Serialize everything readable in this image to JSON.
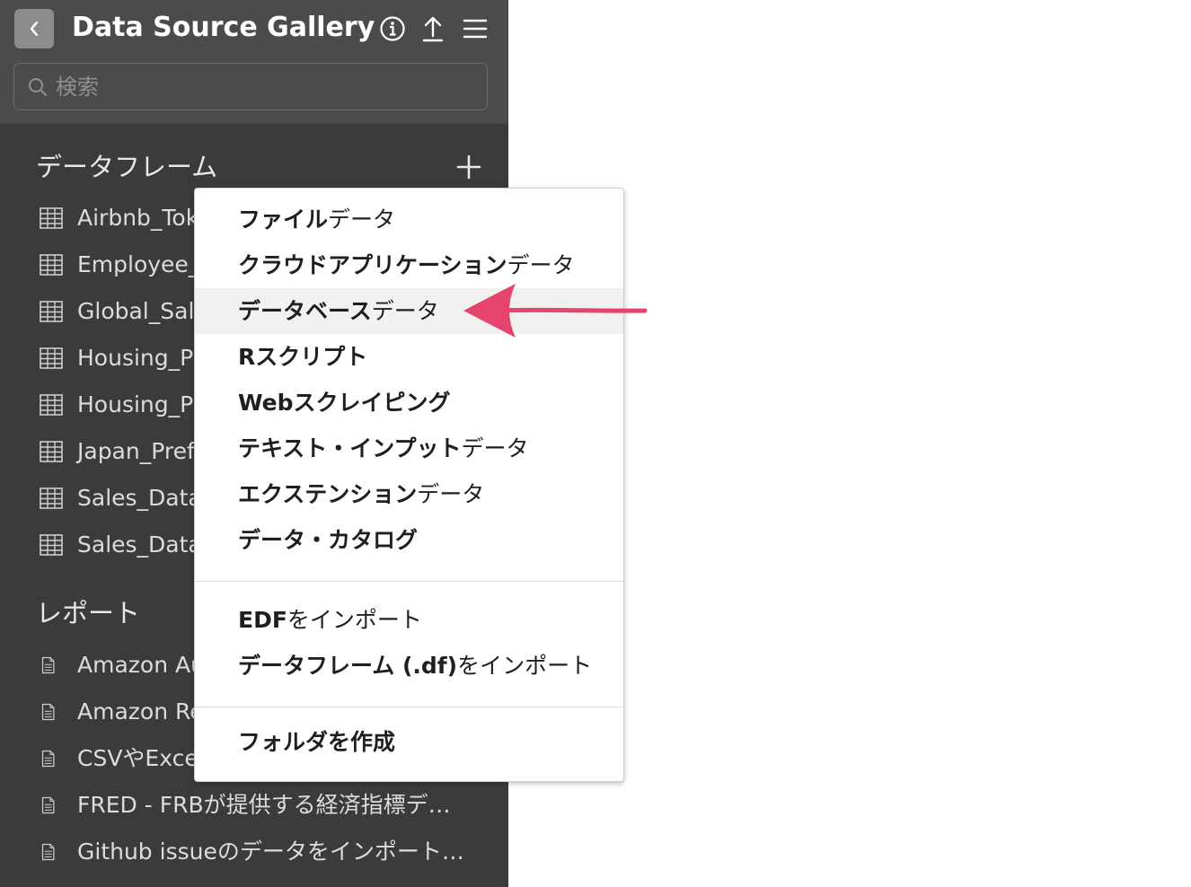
{
  "header": {
    "title": "Data Source Gallery",
    "search_placeholder": "検索"
  },
  "sections": {
    "dataframes": {
      "title": "データフレーム",
      "items": [
        {
          "label": "Airbnb_Tok"
        },
        {
          "label": "Employee_"
        },
        {
          "label": "Global_Sale"
        },
        {
          "label": "Housing_Pr"
        },
        {
          "label": "Housing_Pr"
        },
        {
          "label": "Japan_Pref"
        },
        {
          "label": "Sales_Data"
        },
        {
          "label": "Sales_Data"
        }
      ]
    },
    "reports": {
      "title": "レポート",
      "items": [
        {
          "label": "Amazon Au"
        },
        {
          "label": "Amazon Re"
        },
        {
          "label": "CSVやExce"
        },
        {
          "label": "FRED - FRBが提供する経済指標デ…"
        },
        {
          "label": "Github issueのデータをインポート…"
        }
      ]
    }
  },
  "menu": {
    "items": [
      {
        "bold": "ファイル",
        "rest": "データ"
      },
      {
        "bold": "クラウドアプリケーション",
        "rest": "データ"
      },
      {
        "bold": "データベース",
        "rest": "データ",
        "highlighted": true
      },
      {
        "bold": "Rスクリプト",
        "rest": ""
      },
      {
        "bold": "Webスクレイピング",
        "rest": ""
      },
      {
        "bold": "テキスト・インプット",
        "rest": "データ"
      },
      {
        "bold": "エクステンション",
        "rest": "データ"
      },
      {
        "bold": "データ・カタログ",
        "rest": ""
      }
    ],
    "import_items": [
      {
        "bold": "EDF",
        "rest": "をインポート"
      },
      {
        "bold": "データフレーム (.df)",
        "rest": "をインポート"
      }
    ],
    "create_items": [
      {
        "bold": "フォルダを作成",
        "rest": ""
      }
    ]
  },
  "colors": {
    "sidebar_bg": "#3a3b3c",
    "header_bg": "#4a4b4d",
    "annotation_arrow": "#e5446d"
  }
}
